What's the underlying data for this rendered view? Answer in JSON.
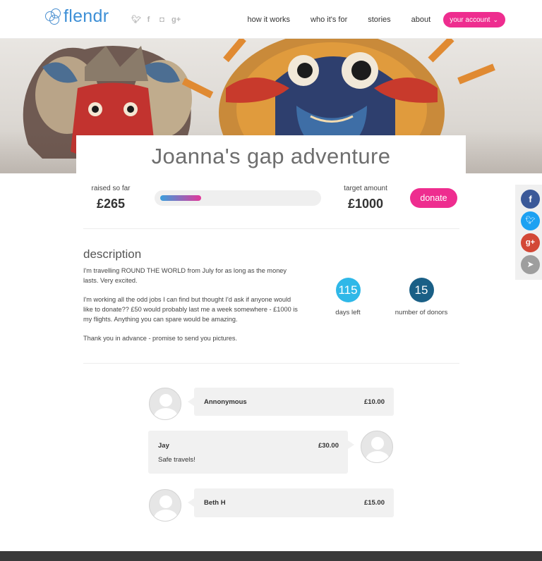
{
  "brand": {
    "name": "flendr",
    "accent": "#ee2d8f",
    "logo_color": "#3d8fd6"
  },
  "header_socials": [
    "twitter-icon",
    "facebook-icon",
    "instagram-icon",
    "google-plus-icon"
  ],
  "nav": {
    "items": [
      "how it works",
      "who it's for",
      "stories",
      "about"
    ],
    "account_label": "your account"
  },
  "campaign": {
    "title": "Joanna's gap adventure",
    "raised_label": "raised so far",
    "raised_value": "£265",
    "target_label": "target amount",
    "target_value": "£1000",
    "progress_fraction": 0.265,
    "donate_label": "donate",
    "description_heading": "description",
    "description_paragraphs": [
      "I'm travelling ROUND THE WORLD from July for as long as the money lasts. Very excited.",
      "I'm working all the odd jobs I can find but thought I'd ask if anyone would like to donate?? £50 would probably last me a week somewhere - £1000 is my flights. Anything you can spare would be amazing.",
      "Thank you in advance - promise to send you pictures."
    ],
    "days_left_value": "115",
    "days_left_label": "days left",
    "donors_value": "15",
    "donors_label": "number of donors"
  },
  "share_sidebar": [
    "facebook-icon",
    "twitter-icon",
    "google-plus-icon",
    "send-icon"
  ],
  "donations": [
    {
      "name": "Annonymous",
      "amount": "£10.00",
      "message": ""
    },
    {
      "name": "Jay",
      "amount": "£30.00",
      "message": "Safe travels!"
    },
    {
      "name": "Beth H",
      "amount": "£15.00",
      "message": ""
    }
  ],
  "colors": {
    "days_circle": "#2fb8e8",
    "donors_circle": "#1a5f86",
    "facebook": "#3b5998",
    "twitter": "#1da1f2",
    "google_plus": "#d34836",
    "send": "#9e9e9e"
  }
}
